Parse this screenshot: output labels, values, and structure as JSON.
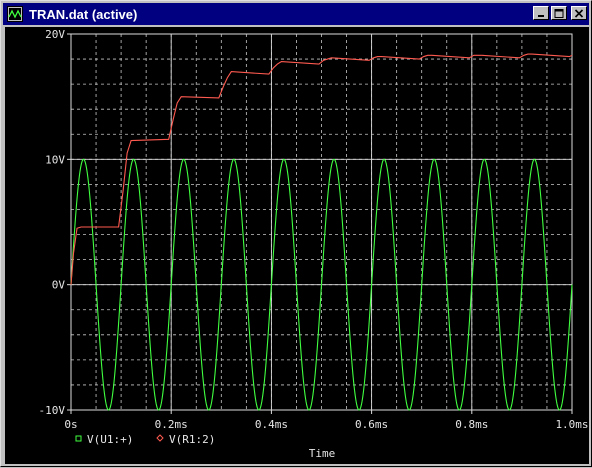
{
  "window": {
    "title": "TRAN.dat (active)"
  },
  "colors": {
    "grid": "#c8c8c8",
    "axis": "#dcdcdc",
    "text": "#e6e6e6",
    "source": "#40ff40",
    "output": "#ff5a50",
    "background": "#000000"
  },
  "icons": [
    "probe-app-icon",
    "minimize-icon",
    "maximize-icon",
    "close-icon"
  ],
  "chart_data": {
    "type": "line",
    "xlabel": "Time",
    "ylabel": "",
    "xlim": [
      0,
      1.0
    ],
    "ylim": [
      -10,
      20
    ],
    "x_ticks": [
      {
        "value": 0,
        "label": "0s"
      },
      {
        "value": 0.2,
        "label": "0.2ms"
      },
      {
        "value": 0.4,
        "label": "0.4ms"
      },
      {
        "value": 0.6,
        "label": "0.6ms"
      },
      {
        "value": 0.8,
        "label": "0.8ms"
      },
      {
        "value": 1.0,
        "label": "1.0ms"
      }
    ],
    "y_ticks": [
      {
        "value": 20,
        "label": "20V"
      },
      {
        "value": 10,
        "label": "10V"
      },
      {
        "value": 0,
        "label": "0V"
      },
      {
        "value": -10,
        "label": "-10V"
      }
    ],
    "grid": true,
    "series": [
      {
        "name": "V(U1:+)",
        "function": "sine",
        "amplitude": 10,
        "frequency_khz": 10,
        "marker": "square"
      },
      {
        "name": "V(R1:2)",
        "marker": "diamond",
        "points": [
          [
            0,
            0
          ],
          [
            0.005,
            2.5
          ],
          [
            0.012,
            4.5
          ],
          [
            0.02,
            4.6
          ],
          [
            0.095,
            4.6
          ],
          [
            0.104,
            7.5
          ],
          [
            0.112,
            10.5
          ],
          [
            0.12,
            11.5
          ],
          [
            0.195,
            11.6
          ],
          [
            0.204,
            13.2
          ],
          [
            0.212,
            14.5
          ],
          [
            0.22,
            15.0
          ],
          [
            0.295,
            14.9
          ],
          [
            0.304,
            15.8
          ],
          [
            0.312,
            16.5
          ],
          [
            0.32,
            17.0
          ],
          [
            0.395,
            16.8
          ],
          [
            0.404,
            17.3
          ],
          [
            0.412,
            17.6
          ],
          [
            0.42,
            17.8
          ],
          [
            0.495,
            17.6
          ],
          [
            0.504,
            17.9
          ],
          [
            0.512,
            18.0
          ],
          [
            0.52,
            18.1
          ],
          [
            0.595,
            17.9
          ],
          [
            0.604,
            18.1
          ],
          [
            0.612,
            18.2
          ],
          [
            0.62,
            18.2
          ],
          [
            0.695,
            18.0
          ],
          [
            0.704,
            18.2
          ],
          [
            0.712,
            18.3
          ],
          [
            0.72,
            18.3
          ],
          [
            0.795,
            18.1
          ],
          [
            0.804,
            18.3
          ],
          [
            0.812,
            18.3
          ],
          [
            0.82,
            18.3
          ],
          [
            0.895,
            18.1
          ],
          [
            0.904,
            18.3
          ],
          [
            0.912,
            18.4
          ],
          [
            0.92,
            18.4
          ],
          [
            0.995,
            18.2
          ],
          [
            1.0,
            18.3
          ]
        ]
      }
    ]
  }
}
